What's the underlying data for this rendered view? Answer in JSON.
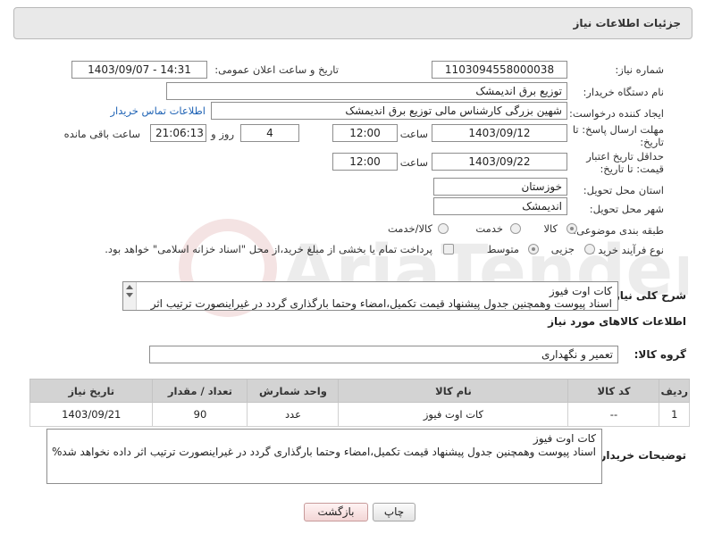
{
  "panel_title": "جزئیات اطلاعات نیاز",
  "watermark_text": "AriaTender.net",
  "fields": {
    "need_number_label": "شماره نیاز:",
    "need_number": "1103094558000038",
    "announce_label": "تاریخ و ساعت اعلان عمومی:",
    "announce_value": "1403/09/07 - 14:31",
    "buyer_org_label": "نام دستگاه خریدار:",
    "buyer_org": "توزیع برق اندیمشک",
    "creator_label": "ایجاد کننده درخواست:",
    "creator": "شهین بزرگی کارشناس مالی توزیع برق اندیمشک",
    "contact_link": "اطلاعات تماس خریدار",
    "reply_deadline_label": "مهلت ارسال پاسخ: تا تاریخ:",
    "reply_date": "1403/09/12",
    "time_label": "ساعت",
    "reply_time": "12:00",
    "days_value": "4",
    "days_label": "روز و",
    "remaining_time": "21:06:13",
    "remaining_label": "ساعت باقی مانده",
    "price_validity_label": "حداقل تاریخ اعتبار قیمت: تا تاریخ:",
    "validity_date": "1403/09/22",
    "validity_time": "12:00",
    "province_label": "استان محل تحویل:",
    "province": "خوزستان",
    "city_label": "شهر محل تحویل:",
    "city": "اندیمشک",
    "category_label": "طبقه بندی موضوعی:",
    "category_options": [
      "کالا",
      "خدمت",
      "کالا/خدمت"
    ],
    "purchase_type_label": "نوع فرآیند خرید :",
    "purchase_options": [
      "جزیی",
      "متوسط"
    ],
    "payment_note": "پرداخت تمام یا بخشی از مبلغ خرید،از محل \"اسناد خزانه اسلامی\" خواهد بود."
  },
  "summary": {
    "label": "شرح کلی نیاز:",
    "line1": "کات اوت فیوز",
    "line2": "اسناد پیوست وهمچنین جدول پیشنهاد قیمت تکمیل،امضاء وحتما بارگذاری گردد در غیراینصورت ترتیب اثر"
  },
  "goods_section_title": "اطلاعات کالاهای مورد نیاز",
  "goods_group_label": "گروه کالا:",
  "goods_group": "تعمیر و نگهداری",
  "table": {
    "headers": [
      "ردیف",
      "کد کالا",
      "نام کالا",
      "واحد شمارش",
      "تعداد / مقدار",
      "تاریخ نیاز"
    ],
    "rows": [
      [
        "1",
        "--",
        "کات اوت فیوز",
        "عدد",
        "90",
        "1403/09/21"
      ]
    ]
  },
  "buyer_notes": {
    "label": "توضیحات خریدار:",
    "line1": "کات اوت فیوز",
    "line2": "اسناد پیوست وهمچنین جدول پیشنهاد قیمت تکمیل،امضاء وحتما بارگذاری گردد در غیراینصورت ترتیب اثر داده نخواهد شد%"
  },
  "buttons": {
    "print": "چاپ",
    "back": "بازگشت"
  }
}
